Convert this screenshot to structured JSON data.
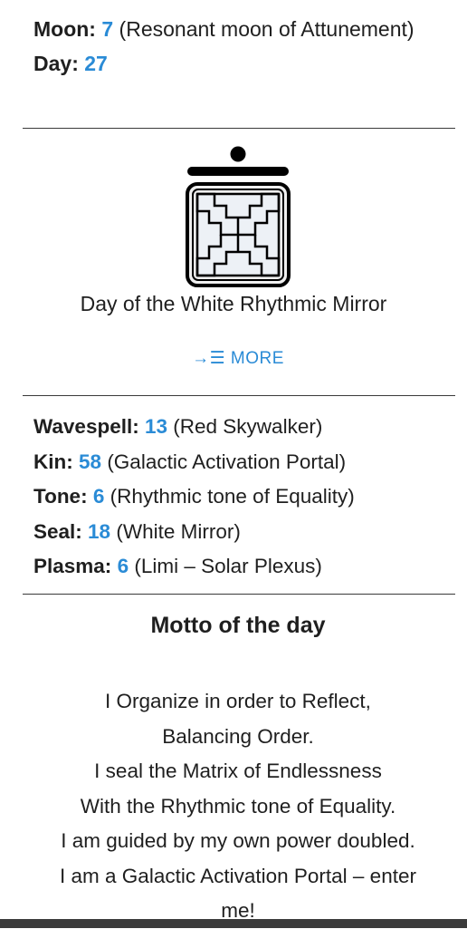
{
  "moon": {
    "label": "Moon:",
    "number": "7",
    "desc": "(Resonant moon of Attunement)"
  },
  "day": {
    "label": "Day:",
    "number": "27"
  },
  "seal": {
    "title": "Day of the White Rhythmic Mirror",
    "more_icon": "→☰",
    "more_label": "MORE",
    "tone_dots": 1,
    "tone_bars": 1
  },
  "stats": [
    {
      "label": "Wavespell:",
      "number": "13",
      "desc": "(Red Skywalker)"
    },
    {
      "label": "Kin:",
      "number": "58",
      "desc": "(Galactic Activation Portal)"
    },
    {
      "label": "Tone:",
      "number": "6",
      "desc": "(Rhythmic tone of Equality)"
    },
    {
      "label": "Seal:",
      "number": "18",
      "desc": "(White Mirror)"
    },
    {
      "label": "Plasma:",
      "number": "6",
      "desc": "(Limi – Solar Plexus)"
    }
  ],
  "motto": {
    "heading": "Motto of the day",
    "lines": [
      "I Organize in order to Reflect,",
      "Balancing Order.",
      "I seal the Matrix of Endlessness",
      "With the Rhythmic tone of Equality.",
      "I am guided by my own power doubled.",
      "I am a Galactic Activation Portal – enter",
      "me!"
    ]
  },
  "colors": {
    "accent": "#2a8bd6",
    "text": "#1f1f1f",
    "divider": "#3a3a3a"
  }
}
